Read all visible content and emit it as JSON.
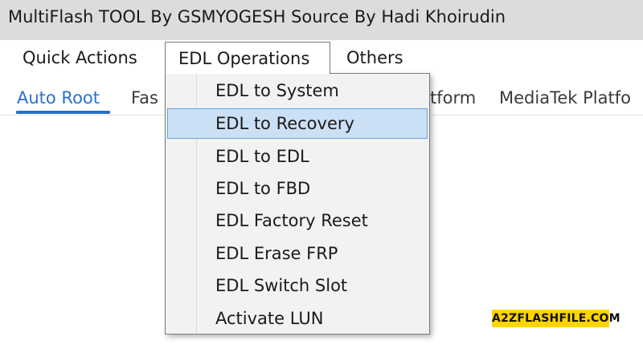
{
  "window": {
    "title": "MultiFlash TOOL By GSMYOGESH Source By Hadi Khoirudin"
  },
  "menubar": {
    "items": [
      {
        "label": "Quick Actions"
      },
      {
        "label": "EDL Operations"
      },
      {
        "label": "Others"
      }
    ]
  },
  "tabs": [
    {
      "label": "Auto Root",
      "active": true
    },
    {
      "label": "Fas"
    },
    {
      "label": "tform"
    },
    {
      "label": "MediaTek Platfo"
    }
  ],
  "dropdown": {
    "items": [
      {
        "label": "EDL to System"
      },
      {
        "label": "EDL to Recovery",
        "highlighted": true
      },
      {
        "label": "EDL to EDL"
      },
      {
        "label": "EDL to FBD"
      },
      {
        "label": "EDL Factory Reset"
      },
      {
        "label": "EDL Erase FRP"
      },
      {
        "label": "EDL Switch Slot"
      },
      {
        "label": "Activate LUN"
      }
    ]
  },
  "watermark": {
    "text": "A2ZFLASHFILE.COM"
  },
  "colors": {
    "accent": "#2a72c8",
    "titlebar_bg": "#dcdcdc",
    "menu_highlight_bg": "#cce0f5",
    "menu_highlight_border": "#6aa0d8",
    "watermark_bg": "#ffd400"
  }
}
